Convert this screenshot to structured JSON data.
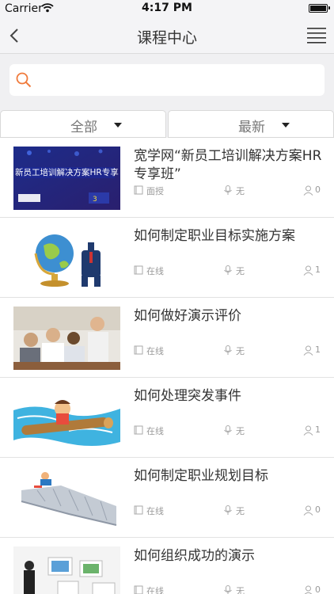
{
  "status_bar": {
    "carrier": "Carrier",
    "time": "4:17 PM"
  },
  "nav": {
    "title": "课程中心",
    "back_icon": "chevron-left-icon",
    "menu_icon": "hamburger-menu-icon"
  },
  "search": {
    "placeholder": "",
    "value": "",
    "icon": "search-icon",
    "accent": "#f07a3b"
  },
  "filters": [
    {
      "label": "全部"
    },
    {
      "label": "最新"
    }
  ],
  "courses": [
    {
      "title": "宽学网“新员工培训解决方案HR专享班”",
      "mode": "面授",
      "teacher": "无",
      "count": "0",
      "thumb_text": "新员工培训解决方案HR专享班"
    },
    {
      "title": "如何制定职业目标实施方案",
      "mode": "在线",
      "teacher": "无",
      "count": "1"
    },
    {
      "title": "如何做好演示评价",
      "mode": "在线",
      "teacher": "无",
      "count": "1"
    },
    {
      "title": "如何处理突发事件",
      "mode": "在线",
      "teacher": "无",
      "count": "1"
    },
    {
      "title": "如何制定职业规划目标",
      "mode": "在线",
      "teacher": "无",
      "count": "0"
    },
    {
      "title": "如何组织成功的演示",
      "mode": "在线",
      "teacher": "无",
      "count": "0"
    }
  ]
}
